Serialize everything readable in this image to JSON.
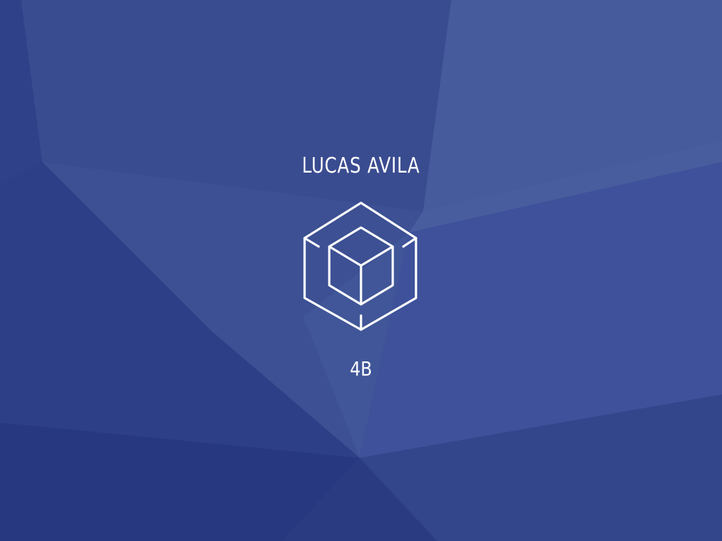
{
  "background": {
    "base_color": "#34478c",
    "palette": [
      "#2a3a82",
      "#3b4f94",
      "#4a5e9e",
      "#26347a",
      "#4a63a4"
    ]
  },
  "user": {
    "name": "LUCAS AVILA",
    "code": "4B"
  },
  "logo": {
    "icon": "nested-cube-icon",
    "color": "#ffffff"
  }
}
